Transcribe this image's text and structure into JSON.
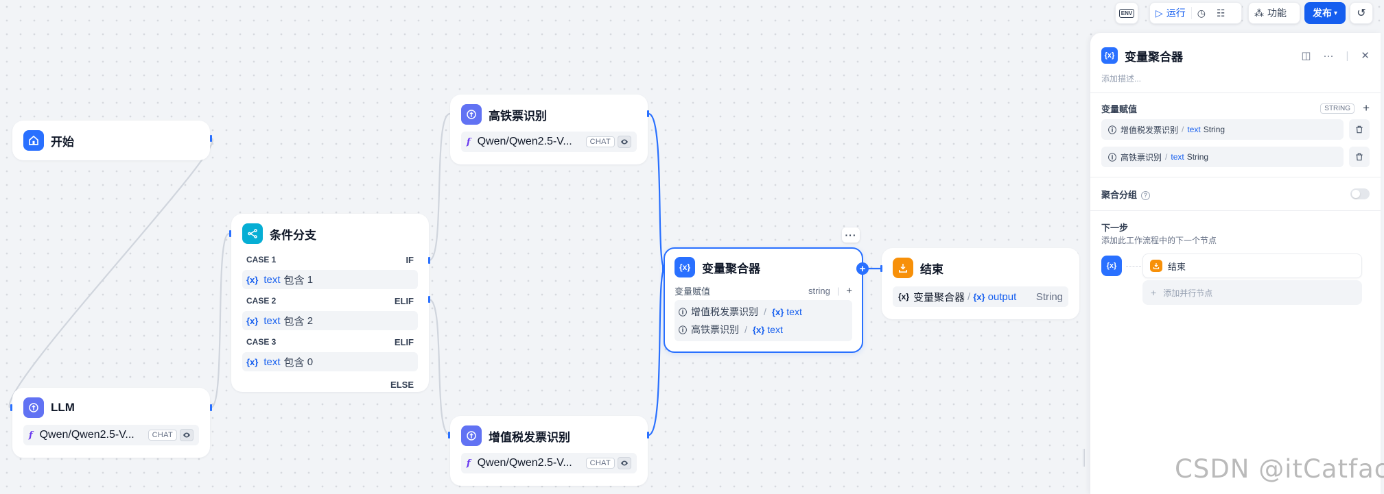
{
  "toolbar": {
    "env_label": "ENV",
    "run_label": "运行",
    "features_label": "功能",
    "publish_label": "发布",
    "colors": {
      "accent": "#155eef",
      "publish_bg": "#155eef"
    }
  },
  "nodes": {
    "start": {
      "title": "开始",
      "icon": "home-icon"
    },
    "llm": {
      "title": "LLM",
      "model": "Qwen/Qwen2.5-V...",
      "chip": "CHAT",
      "icon": "llm-icon"
    },
    "branch": {
      "title": "条件分支",
      "icon": "branch-icon",
      "cases": [
        {
          "label": "CASE 1",
          "keyword": "IF",
          "var": "text",
          "op": "包含",
          "value": "1"
        },
        {
          "label": "CASE 2",
          "keyword": "ELIF",
          "var": "text",
          "op": "包含",
          "value": "2"
        },
        {
          "label": "CASE 3",
          "keyword": "ELIF",
          "var": "text",
          "op": "包含",
          "value": "0"
        }
      ],
      "else_label": "ELSE"
    },
    "train": {
      "title": "高铁票识别",
      "model": "Qwen/Qwen2.5-V...",
      "chip": "CHAT",
      "icon": "llm-icon"
    },
    "vat": {
      "title": "增值税发票识别",
      "model": "Qwen/Qwen2.5-V...",
      "chip": "CHAT",
      "icon": "llm-icon"
    },
    "aggregator": {
      "title": "变量聚合器",
      "icon": "variable-icon",
      "label": "变量赋值",
      "type": "string",
      "items": [
        {
          "node": "增值税发票识别",
          "var": "text"
        },
        {
          "node": "高铁票识别",
          "var": "text"
        }
      ]
    },
    "end": {
      "title": "结束",
      "icon": "end-icon",
      "node": "变量聚合器",
      "var": "output",
      "type": "String"
    }
  },
  "var_icon_text": "{x}",
  "panel": {
    "title": "变量聚合器",
    "description_placeholder": "添加描述...",
    "assign_label": "变量赋值",
    "type_chip": "STRING",
    "vars": [
      {
        "node": "增值税发票识别",
        "var": "text",
        "type": "String"
      },
      {
        "node": "高铁票识别",
        "var": "text",
        "type": "String"
      }
    ],
    "group_label": "聚合分组",
    "group_enabled": false,
    "next_title": "下一步",
    "next_sub": "添加此工作流程中的下一个节点",
    "next_node": "结束",
    "add_parallel": "添加并行节点"
  },
  "watermark": "CSDN @itCatface"
}
